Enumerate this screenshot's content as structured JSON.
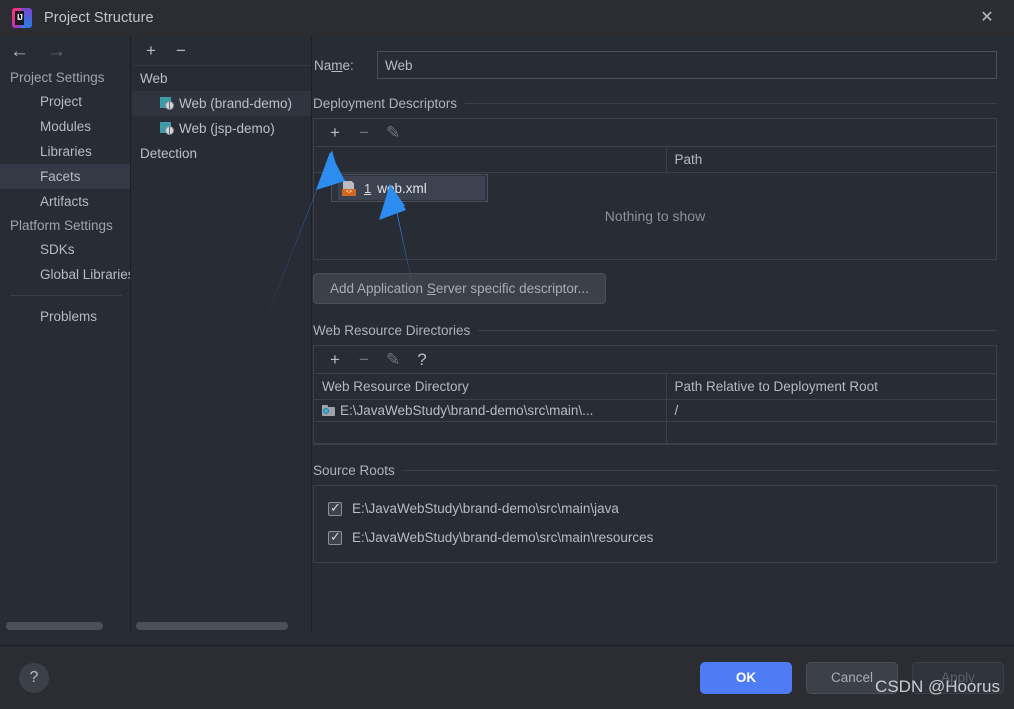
{
  "window": {
    "title": "Project Structure",
    "logo_text": "IJ",
    "close_icon": "close-icon"
  },
  "sidebar": {
    "nav": {
      "back_icon": "←",
      "forward_icon": "→"
    },
    "groups": [
      {
        "label": "Project Settings",
        "items": [
          {
            "label": "Project",
            "selected": false
          },
          {
            "label": "Modules",
            "selected": false
          },
          {
            "label": "Libraries",
            "selected": false
          },
          {
            "label": "Facets",
            "selected": true
          },
          {
            "label": "Artifacts",
            "selected": false
          }
        ]
      },
      {
        "label": "Platform Settings",
        "items": [
          {
            "label": "SDKs",
            "selected": false
          },
          {
            "label": "Global Libraries",
            "selected": false
          }
        ]
      }
    ],
    "footer_items": [
      {
        "label": "Problems",
        "selected": false
      }
    ]
  },
  "tree": {
    "toolbar": [
      {
        "name": "add-facet-button",
        "glyph": "+"
      },
      {
        "name": "remove-facet-button",
        "glyph": "−"
      }
    ],
    "rows": [
      {
        "label": "Web",
        "type": "group",
        "selected": false
      },
      {
        "label": "Web (brand-demo)",
        "type": "facet",
        "selected": true
      },
      {
        "label": "Web (jsp-demo)",
        "type": "facet",
        "selected": false
      },
      {
        "label": "Detection",
        "type": "group",
        "selected": false
      }
    ]
  },
  "main": {
    "name_field": {
      "label": "Name:",
      "mnemonic": "m",
      "value": "Web",
      "placeholder": ""
    },
    "deployment_descriptors": {
      "title": "Deployment Descriptors",
      "toolbar": [
        {
          "name": "add-descriptor-button",
          "glyph": "+"
        },
        {
          "name": "remove-descriptor-button",
          "glyph": "−"
        },
        {
          "name": "edit-descriptor-button",
          "glyph": "✎"
        }
      ],
      "columns": [
        "",
        "Path"
      ],
      "rows": [],
      "empty_text": "Nothing to show",
      "add_server_button": {
        "prefix": "Add Application ",
        "mnemonic": "S",
        "suffix": "erver specific descriptor..."
      }
    },
    "web_resource_directories": {
      "title": "Web Resource Directories",
      "toolbar": [
        {
          "name": "add-web-resource-button",
          "glyph": "+"
        },
        {
          "name": "remove-web-resource-button",
          "glyph": "−"
        },
        {
          "name": "edit-web-resource-button",
          "glyph": "✎"
        },
        {
          "name": "help-web-resource-button",
          "glyph": "?"
        }
      ],
      "columns": [
        "Web Resource Directory",
        "Path Relative to Deployment Root"
      ],
      "rows": [
        {
          "directory": "E:\\JavaWebStudy\\brand-demo\\src\\main\\...",
          "relative_path": "/"
        }
      ]
    },
    "source_roots": {
      "title": "Source Roots",
      "items": [
        {
          "label": "E:\\JavaWebStudy\\brand-demo\\src\\main\\java",
          "checked": true
        },
        {
          "label": "E:\\JavaWebStudy\\brand-demo\\src\\main\\resources",
          "checked": true
        }
      ]
    }
  },
  "popup_menu": {
    "items": [
      {
        "mnemonic": "1",
        "label": "web.xml",
        "icon": "xml-file-icon",
        "highlighted": true
      }
    ]
  },
  "bottom_bar": {
    "help_glyph": "?",
    "buttons": [
      {
        "label": "OK",
        "style": "primary",
        "enabled": true
      },
      {
        "label": "Cancel",
        "style": "normal",
        "enabled": true
      },
      {
        "label": "Apply",
        "style": "disabled",
        "enabled": false
      }
    ]
  },
  "watermark": {
    "text": "CSDN @Hoorus"
  },
  "colors": {
    "accent_blue": "#4d7cf5",
    "arrow_blue": "#2d8cf0",
    "background": "#282c34",
    "titlebar": "#2b2d33",
    "selection": "#343945",
    "xml_badge_orange": "#d2671e"
  }
}
